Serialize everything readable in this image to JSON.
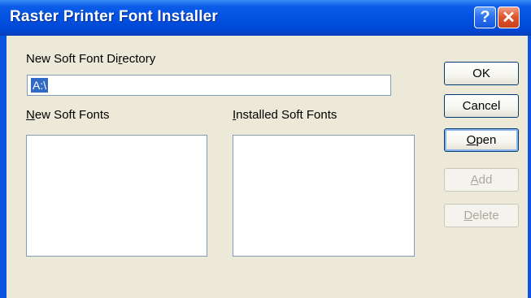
{
  "window": {
    "title": "Raster Printer Font Installer"
  },
  "titlebar": {
    "help_label": "?",
    "close_label": "✕"
  },
  "directory": {
    "label_prefix": "New Soft Font Di",
    "label_underline": "r",
    "label_suffix": "ectory",
    "value": "A:\\"
  },
  "lists": {
    "new_underline": "N",
    "new_suffix": "ew Soft Fonts",
    "installed_underline": "I",
    "installed_suffix": "nstalled Soft Fonts"
  },
  "buttons": {
    "ok": "OK",
    "cancel": "Cancel",
    "open_underline": "O",
    "open_suffix": "pen",
    "add_underline": "A",
    "add_suffix": "dd",
    "delete_underline": "D",
    "delete_suffix": "elete"
  }
}
